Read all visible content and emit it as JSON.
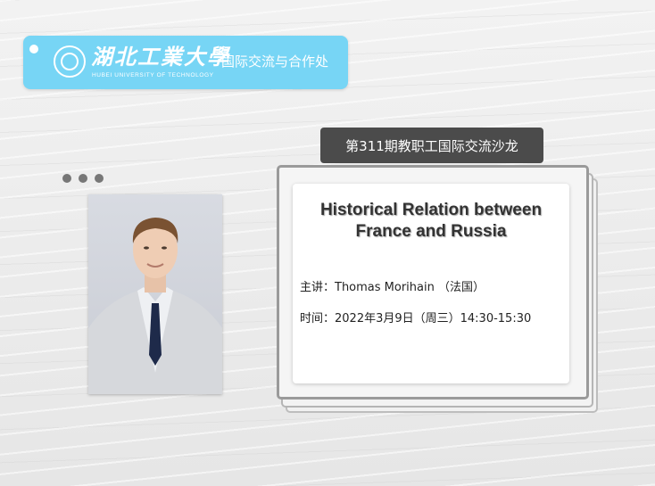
{
  "header": {
    "university_cn": "湖北工業大學",
    "university_en": "HUBEI UNIVERSITY OF TECHNOLOGY",
    "department": "国际交流与合作处",
    "logo_icon": "university-seal-icon"
  },
  "event": {
    "series_label": "第311期教职工国际交流沙龙",
    "title_line1": "Historical Relation between",
    "title_line2": "France and Russia",
    "speaker_line": "主讲：Thomas Morihain （法国）",
    "time_line": "时间：2022年3月9日（周三）14:30-15:30"
  },
  "photo": {
    "subject": "speaker-portrait"
  },
  "colors": {
    "banner": "#77d5f5",
    "label_bg": "#4b4b4b",
    "card_bg": "#ffffff",
    "text_dark": "#333333"
  }
}
